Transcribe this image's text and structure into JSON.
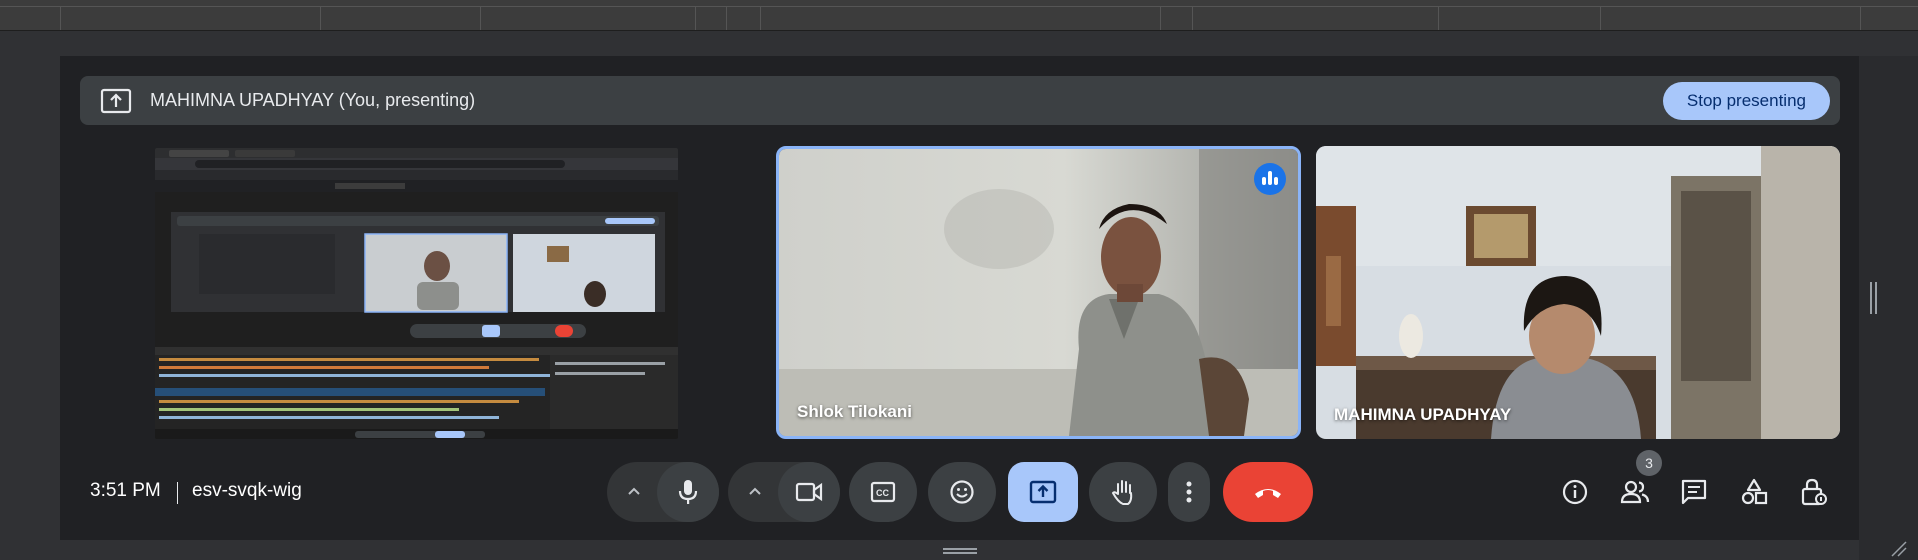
{
  "banner": {
    "presenter_label": "MAHIMNA UPADHYAY (You, presenting)",
    "stop_label": "Stop presenting",
    "icon": "present-to-all-icon"
  },
  "tiles": [
    {
      "name": "Shlok Tilokani",
      "speaking": true
    },
    {
      "name": "MAHIMNA UPADHYAY",
      "speaking": false
    }
  ],
  "meeting": {
    "time": "3:51 PM",
    "code": "esv-svqk-wig"
  },
  "controls": {
    "icons": [
      "chevron-up-icon",
      "mic-icon",
      "chevron-up-icon",
      "camera-icon",
      "captions-icon",
      "emoji-icon",
      "present-icon",
      "raise-hand-icon",
      "more-vert-icon",
      "call-end-icon"
    ],
    "present_active": true
  },
  "secondary": {
    "icons": [
      "info-icon",
      "people-icon",
      "chat-icon",
      "activities-icon",
      "host-controls-icon"
    ],
    "people_count": "3"
  },
  "colors": {
    "accent": "#a8c7fa",
    "end_call": "#ea4335",
    "speaking_border": "#8ab4f8",
    "surface": "#202124"
  }
}
